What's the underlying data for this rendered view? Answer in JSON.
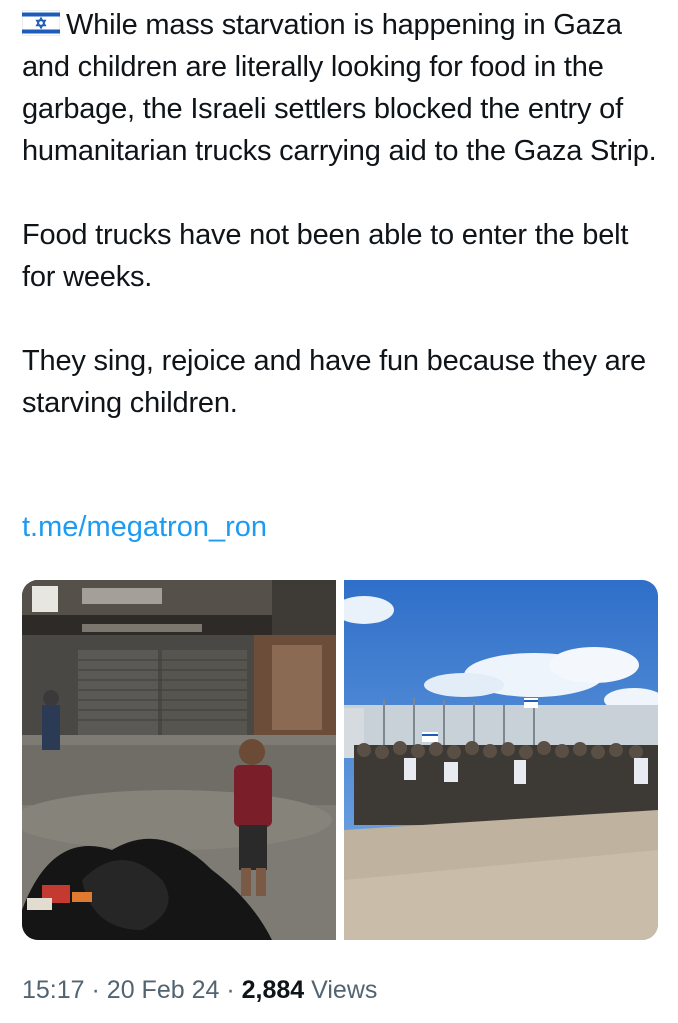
{
  "tweet": {
    "paragraphs": [
      "While mass starvation is happening in Gaza and children are literally looking for food in the garbage, the Israeli settlers blocked the entry of humanitarian trucks carrying aid to the Gaza Strip.",
      "Food trucks have not been able to enter the belt for weeks.",
      "They sing, rejoice and have fun because they are starving children."
    ],
    "flag_icon": "israel-flag-icon",
    "link": "t.me/megatron_ron",
    "media": [
      {
        "icon": "photo-child-garbage"
      },
      {
        "icon": "photo-crowd-road"
      }
    ],
    "time": "15:17",
    "date": "20 Feb 24",
    "views_count": "2,884",
    "views_label": "Views",
    "separator": "·"
  }
}
